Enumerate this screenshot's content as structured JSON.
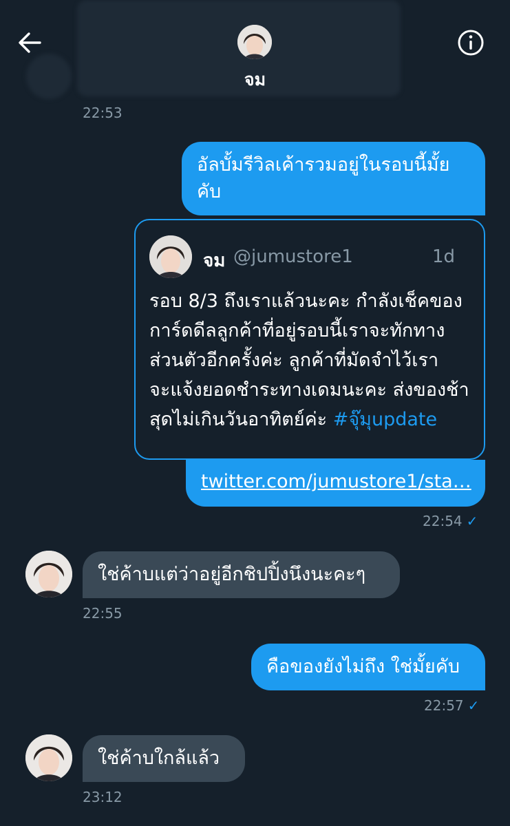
{
  "header": {
    "name": "จม"
  },
  "messages": {
    "m0_time": "22:53",
    "m1_text": "อัลบั้มรีวิลเค้ารวมอยู่ในรอบนี้มั้ยคับ",
    "quote": {
      "name": "จม",
      "handle": "@jumustore1",
      "age": "1d",
      "text": "รอบ 8/3 ถึงเราแล้วนะคะ กำลังเช็คของการ์ดดีลลูกค้าที่อยู่รอบนี้เราจะทักทางส่วนตัวอีกครั้งค่ะ ลูกค้าที่มัดจำไว้เราจะแจ้งยอดชำระทางเดมนะคะ ส่งของช้าสุดไม่เกินวันอาทิตย์ค่ะ ",
      "hashtag": "#จุ๊มุupdate"
    },
    "link": "twitter.com/jumustore1/sta…",
    "m1_time": "22:54",
    "m2_text": "ใช่ค้าบแต่ว่าอยู่อีกชิปปิ้งนึงนะคะๆ",
    "m2_time": "22:55",
    "m3_text": "คือของยังไม่ถึง ใช่มั้ยคับ",
    "m3_time": "22:57",
    "m4_text": "ใช่ค้าบใกล้แล้ว",
    "m4_time": "23:12"
  },
  "icons": {
    "back": "arrow-left-icon",
    "info": "info-circle-icon",
    "read": "check-icon"
  },
  "colors": {
    "background": "#15202b",
    "accent": "#1d9bf0",
    "incoming": "#3a4956",
    "muted": "#8899a6"
  }
}
